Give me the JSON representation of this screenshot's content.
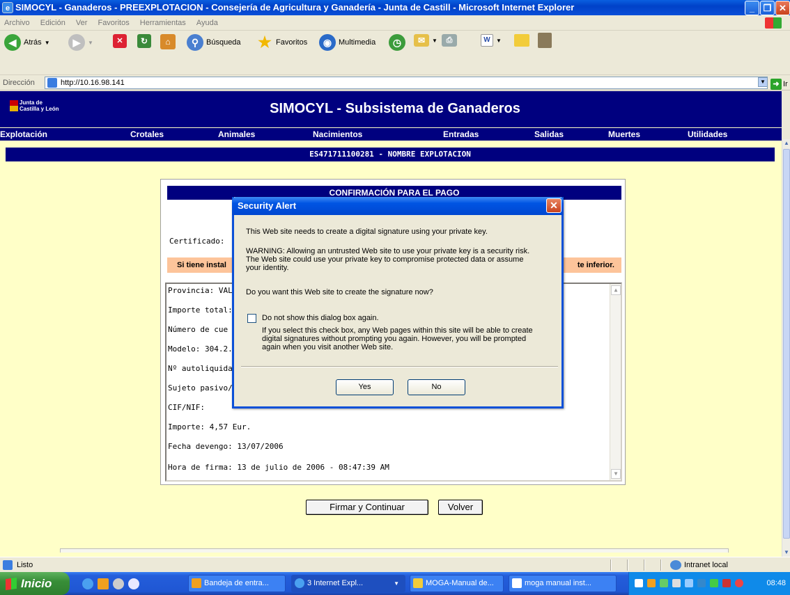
{
  "window": {
    "title": "SIMOCYL - Ganaderos - PREEXPLOTACION - Consejería de Agricultura y Ganadería - Junta de Castill - Microsoft Internet Explorer"
  },
  "menu": [
    "Archivo",
    "Edición",
    "Ver",
    "Favoritos",
    "Herramientas",
    "Ayuda"
  ],
  "toolbar": {
    "back": "Atrás",
    "search": "Búsqueda",
    "favorites": "Favoritos",
    "multimedia": "Multimedia"
  },
  "address": {
    "label": "Dirección",
    "url": "http://10.16.98.141",
    "go": "Ir"
  },
  "site": {
    "logo_line1": "Junta de",
    "logo_line2": "Castilla y León",
    "title": "SIMOCYL - Subsistema de Ganaderos",
    "nav": [
      "Explotación",
      "Crotales",
      "Animales",
      "Nacimientos",
      "Entradas",
      "Salidas",
      "Muertes",
      "Utilidades"
    ],
    "explotacion": "ES471711100281 - NOMBRE EXPLOTACION"
  },
  "page": {
    "conf_title": "CONFIRMACIÓN PARA EL PAGO",
    "cert_label": "Certificado:",
    "warn_left": "Si tiene instal",
    "warn_right": "te inferior.",
    "details": [
      "Provincia: VAL",
      "Importe total:",
      "Número de cue",
      "Modelo: 304.2.",
      "Nº autoliquidad",
      "Sujeto pasivo/",
      "CIF/NIF:",
      "Importe: 4,57 Eur.",
      "Fecha devengo: 13/07/2006",
      "Hora de firma: 13 de julio de 2006 - 08:47:39 AM"
    ],
    "sign_button": "Firmar y Continuar",
    "back_button": "Volver"
  },
  "dialog": {
    "title": "Security Alert",
    "line1": "This Web site needs to create a digital signature using your private key.",
    "warning1": "WARNING: Allowing an untrusted Web site to use your private key is a security risk.",
    "warning2": "The Web site could use your private key to compromise protected data or assume",
    "warning3": "your identity.",
    "question": "Do you want this Web site to create the signature now?",
    "checkbox_label": "Do not show this dialog box again.",
    "info1": "If you select this check box, any Web pages within this site will be able to create",
    "info2": "digital signatures without prompting you again. However, you will be prompted",
    "info3": "again when you visit another Web site.",
    "yes": "Yes",
    "no": "No",
    "checked": false
  },
  "status": {
    "left": "Listo",
    "zone": "Intranet local"
  },
  "taskbar": {
    "start": "Inicio",
    "tasks": [
      "Bandeja de entra...",
      "3 Internet Expl...",
      "MOGA-Manual de...",
      "moga manual inst..."
    ],
    "clock": "08:48"
  },
  "colors": {
    "header_blue": "#00007f",
    "page_bg": "#ffffc8",
    "warn_bg": "#fdc49a",
    "xp_blue": "#0054e3"
  }
}
